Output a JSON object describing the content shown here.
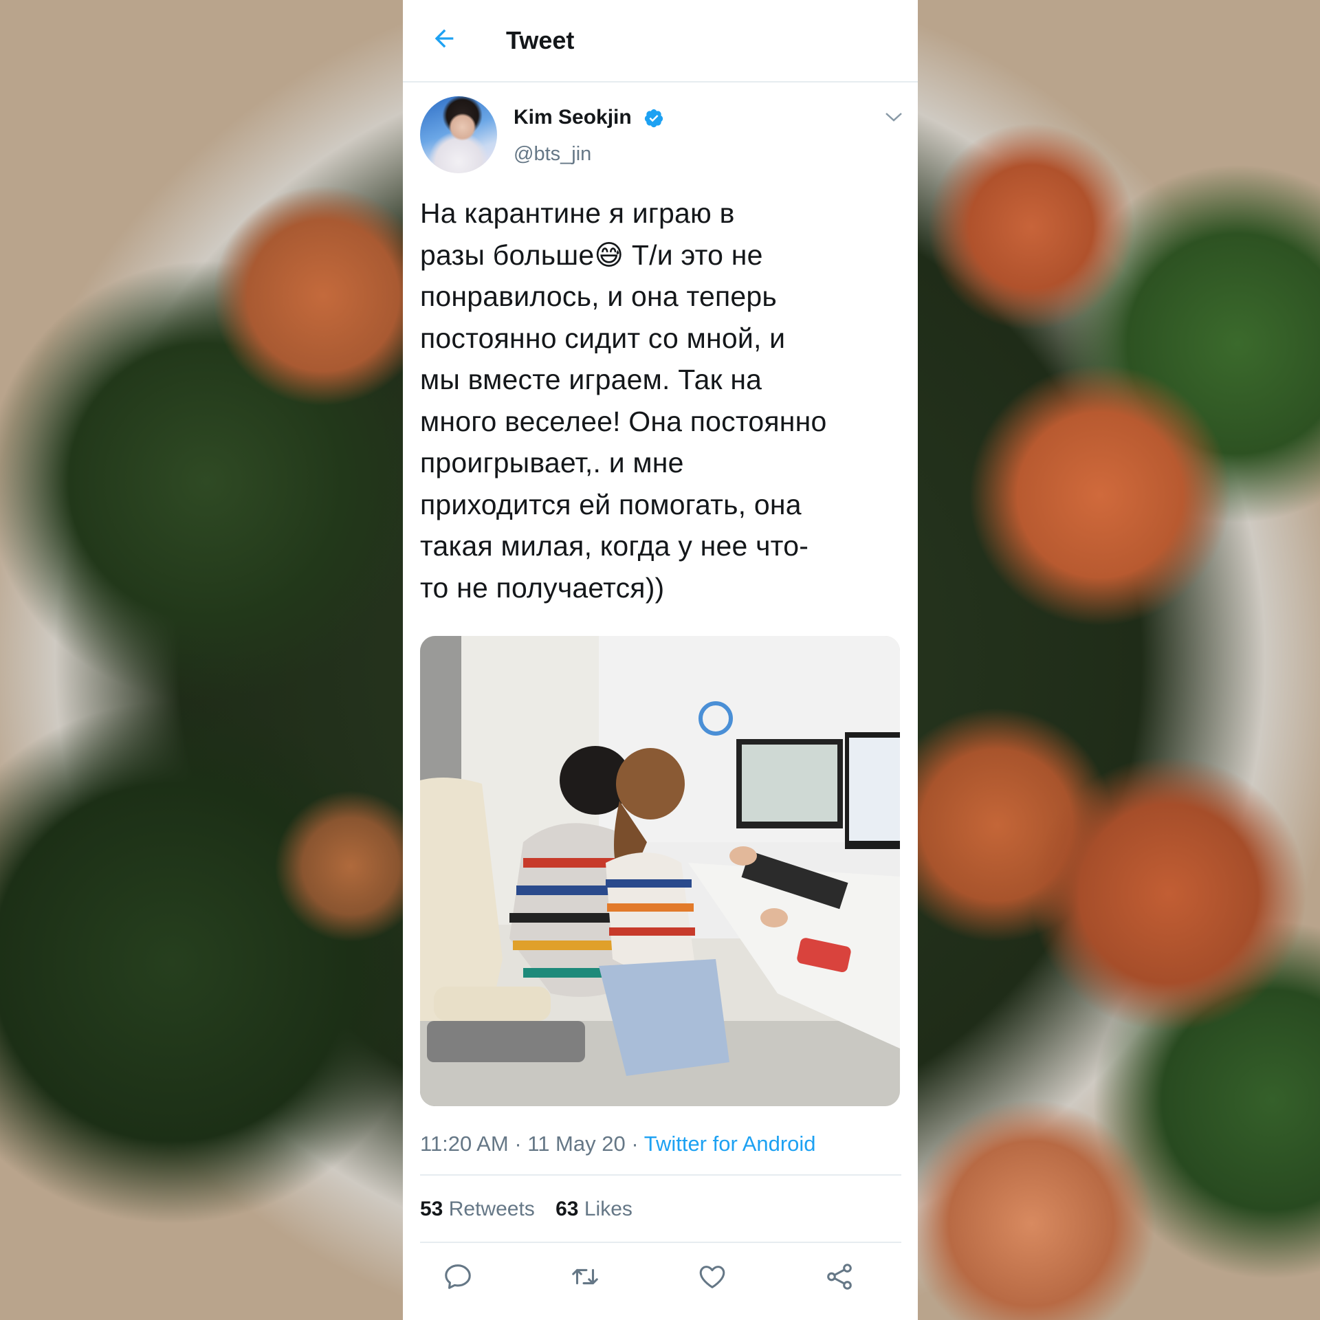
{
  "header": {
    "title": "Tweet"
  },
  "user": {
    "name": "Kim Seokjin",
    "handle": "@bts_jin",
    "verified": true
  },
  "tweet": {
    "text": "На карантине я играю в\nразы больше😅 Т/и это не\nпонравилось, и она теперь\nпостоянно сидит со мной, и\nмы вместе играем. Так на\nмного веселее! Она постоянно\nпроигрывает,. и мне\nприходится ей помогать, она\nтакая милая, когда у нее что-\nто не получается))",
    "time": "11:20 AM",
    "date": "11 May 20",
    "source": "Twitter for Android"
  },
  "stats": {
    "retweets_count": "53",
    "retweets_label": "Retweets",
    "likes_count": "63",
    "likes_label": "Likes"
  },
  "icons": {
    "back": "back-arrow-icon",
    "verified": "verified-badge-icon",
    "more": "chevron-down-icon",
    "actions": [
      "reply-icon",
      "retweet-icon",
      "like-icon",
      "share-icon"
    ]
  },
  "colors": {
    "accent": "#1da1f2",
    "text": "#14171a",
    "secondary": "#657786",
    "divider": "#e6ecf0"
  }
}
